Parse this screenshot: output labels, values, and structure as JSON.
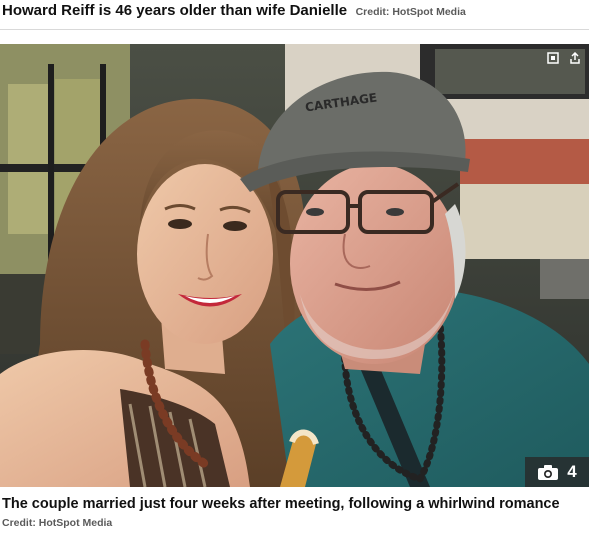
{
  "header": {
    "title": "Howard Reiff is 46 years older than wife Danielle",
    "credit": "Credit: HotSpot Media"
  },
  "photo": {
    "alt": "",
    "cap_text": "CARTHAGE",
    "gallery_count": "4",
    "icons": {
      "expand": "expand-icon",
      "share": "share-icon",
      "camera": "camera-icon"
    }
  },
  "footer": {
    "caption": "The couple married just four weeks after meeting, following a whirlwind romance",
    "credit": "Credit: HotSpot Media"
  },
  "colors": {
    "credit_gray": "#5a5a5a",
    "badge_bg": "#282828"
  }
}
